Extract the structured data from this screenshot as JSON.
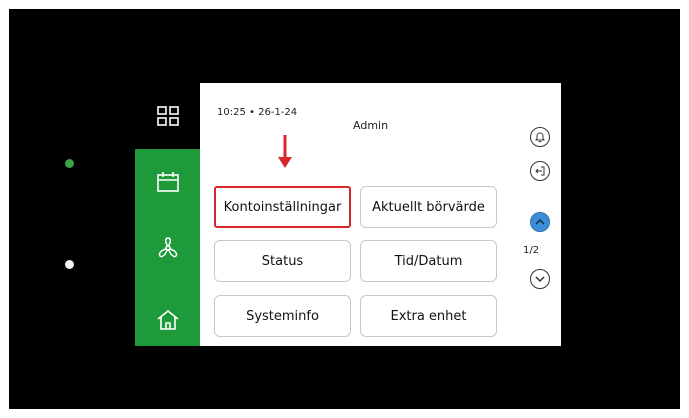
{
  "header": {
    "time": "10:25",
    "separator": "•",
    "date": "26-1-24",
    "user": "Admin"
  },
  "sidebar": {
    "items": [
      {
        "icon": "grid-icon",
        "active": true
      },
      {
        "icon": "calendar-icon",
        "active": false
      },
      {
        "icon": "fan-icon",
        "active": false
      },
      {
        "icon": "home-icon",
        "active": false
      }
    ]
  },
  "menu": {
    "buttons": [
      {
        "label": "Kontoinställningar",
        "highlighted": true
      },
      {
        "label": "Aktuellt börvärde",
        "highlighted": false
      },
      {
        "label": "Status",
        "highlighted": false
      },
      {
        "label": "Tid/Datum",
        "highlighted": false
      },
      {
        "label": "Systeminfo",
        "highlighted": false
      },
      {
        "label": "Extra enhet",
        "highlighted": false
      }
    ]
  },
  "pagination": {
    "current": 1,
    "total": 2,
    "label": "1/2"
  },
  "right_icons": [
    "bell-icon",
    "logout-icon",
    "chevron-up-icon",
    "chevron-down-icon"
  ],
  "colors": {
    "sidebar": "#1f9a3a",
    "sidebar_active": "#000000",
    "highlight": "#d9252c",
    "scroll_up_active": "#3c8fd6",
    "led_status": "#3aa24a"
  }
}
